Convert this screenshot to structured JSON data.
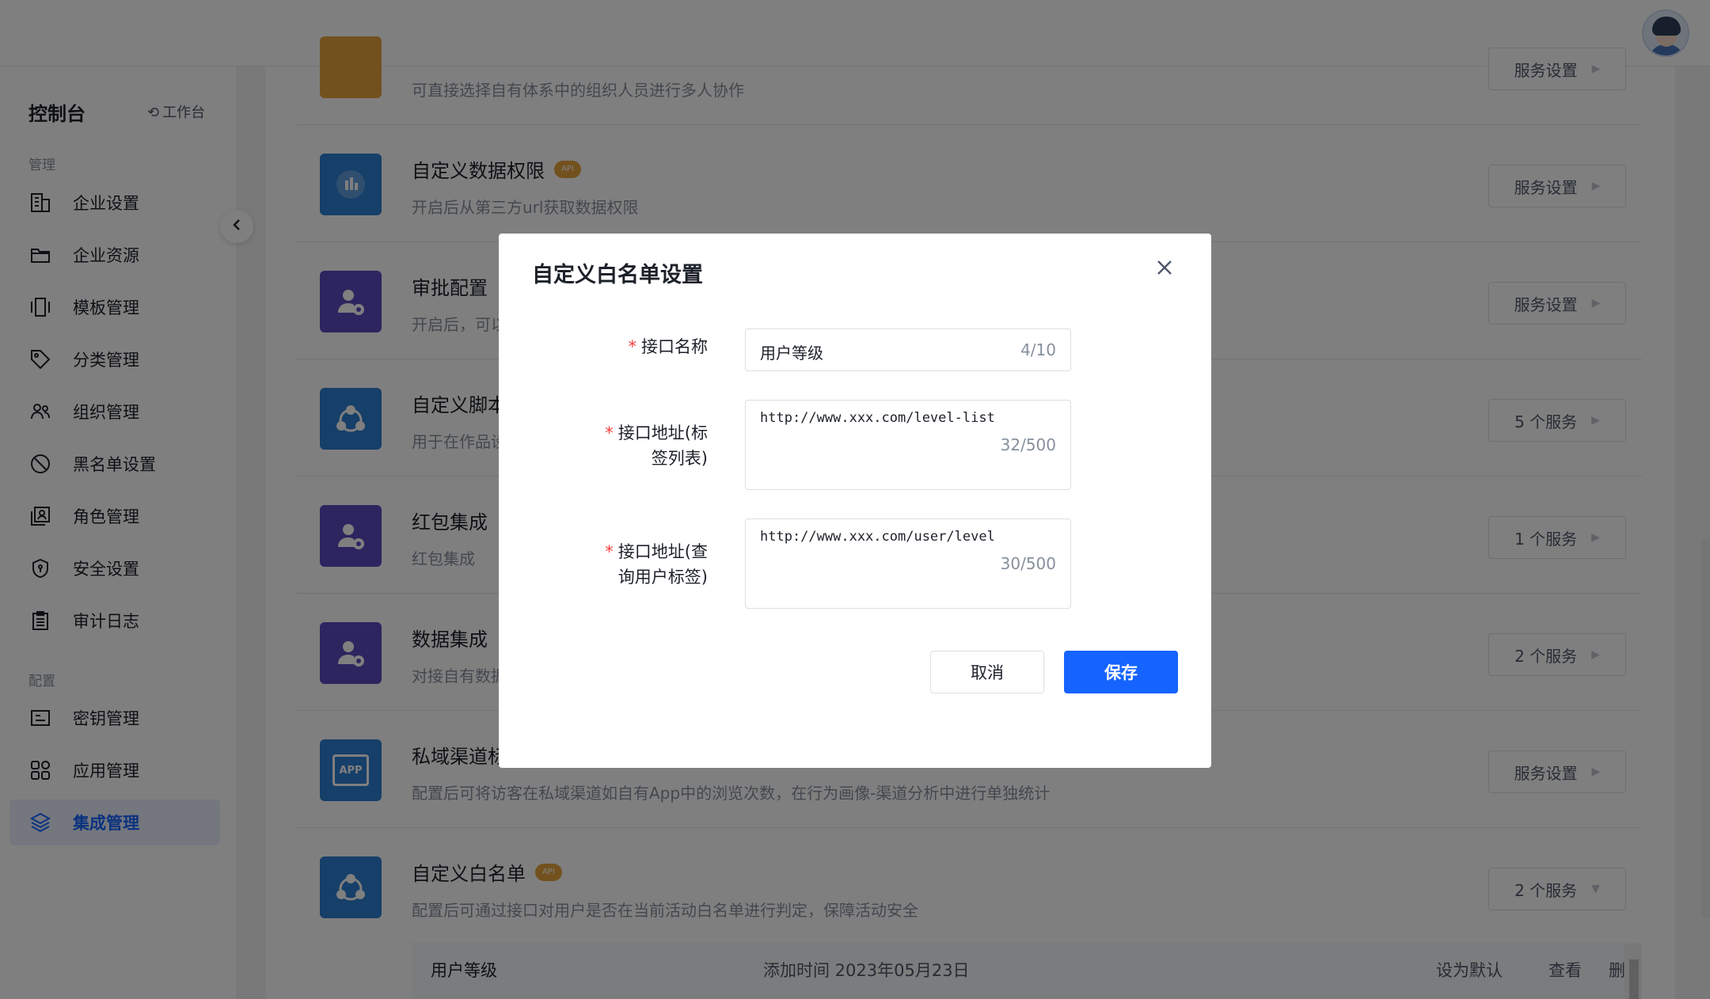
{
  "sidebar": {
    "title": "控制台",
    "switch_label": "工作台",
    "section_manage": "管理",
    "section_config": "配置",
    "items": [
      {
        "label": "企业设置",
        "icon": "building-icon"
      },
      {
        "label": "企业资源",
        "icon": "folder-icon"
      },
      {
        "label": "模板管理",
        "icon": "template-icon"
      },
      {
        "label": "分类管理",
        "icon": "tag-icon"
      },
      {
        "label": "组织管理",
        "icon": "users-icon"
      },
      {
        "label": "黑名单设置",
        "icon": "ban-icon"
      },
      {
        "label": "角色管理",
        "icon": "role-icon"
      },
      {
        "label": "安全设置",
        "icon": "shield-icon"
      },
      {
        "label": "审计日志",
        "icon": "clipboard-icon"
      },
      {
        "label": "密钥管理",
        "icon": "key-icon"
      },
      {
        "label": "应用管理",
        "icon": "apps-icon"
      },
      {
        "label": "集成管理",
        "icon": "layers-icon",
        "active": true
      }
    ]
  },
  "services": [
    {
      "title": "",
      "desc": "可直接选择自有体系中的组织人员进行多人协作",
      "button": "服务设置",
      "api": false,
      "color": "#e6a23c"
    },
    {
      "title": "自定义数据权限",
      "desc": "开启后从第三方url获取数据权限",
      "button": "服务设置",
      "api": true,
      "color": "#2d7fd3"
    },
    {
      "title": "审批配置",
      "desc": "开启后，可以",
      "button": "服务设置",
      "api": false,
      "color": "#5b4ac0"
    },
    {
      "title": "自定义脚本",
      "desc": "用于在作品设",
      "button": "5 个服务",
      "api": false,
      "color": "#2d7fd3"
    },
    {
      "title": "红包集成",
      "desc": "红包集成",
      "button": "1 个服务",
      "api": false,
      "color": "#5b4ac0"
    },
    {
      "title": "数据集成",
      "desc": "对接自有数据",
      "button": "2 个服务",
      "api": false,
      "color": "#5b4ac0"
    },
    {
      "title": "私域渠道标",
      "desc": "配置后可将访客在私域渠道如自有App中的浏览次数，在行为画像-渠道分析中进行单独统计",
      "button": "服务设置",
      "api": false,
      "color": "#2d7fd3"
    },
    {
      "title": "自定义白名单",
      "desc": "配置后可通过接口对用户是否在当前活动白名单进行判定，保障活动安全",
      "button": "2 个服务",
      "api": true,
      "color": "#2d7fd3"
    }
  ],
  "api_badge": "API",
  "app_icon_text": "APP",
  "sub_item": {
    "name": "用户等级",
    "time": "添加时间 2023年05月23日",
    "action_default": "设为默认",
    "action_view": "查看",
    "action_delete": "删除"
  },
  "modal": {
    "title": "自定义白名单设置",
    "fields": [
      {
        "label": "接口名称",
        "value": "用户等级",
        "count": "4/10"
      },
      {
        "label_line1": "接口地址(标",
        "label_line2": "签列表)",
        "value": "http://www.xxx.com/level-list",
        "count": "32/500"
      },
      {
        "label_line1": "接口地址(查",
        "label_line2": "询用户标签)",
        "value": "http://www.xxx.com/user/level",
        "count": "30/500"
      }
    ],
    "cancel": "取消",
    "save": "保存"
  },
  "colors": {
    "primary": "#1664ff",
    "required": "#f53f3f",
    "api_badge": "#e6a23c"
  }
}
